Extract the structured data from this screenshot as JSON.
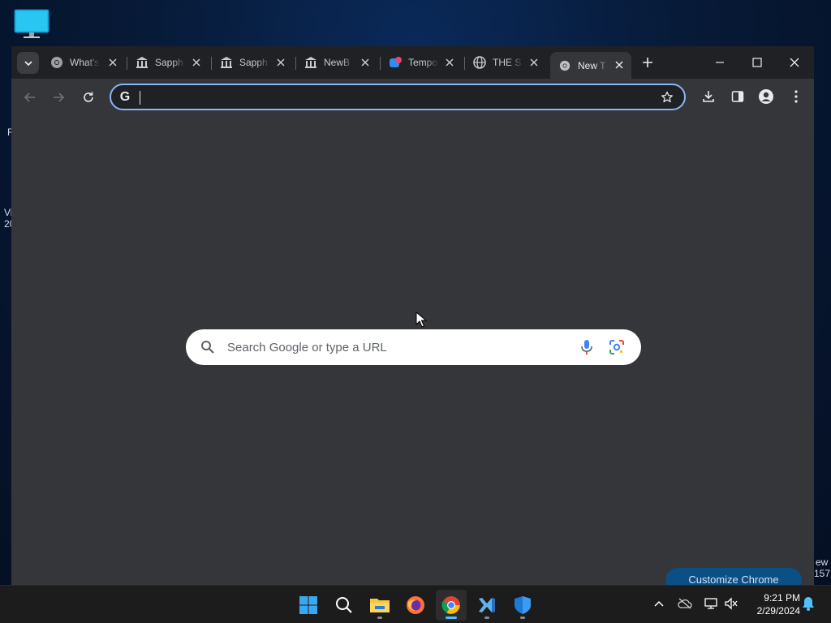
{
  "desktop": {
    "icon_name": "monitor-icon",
    "peek_texts": [
      "R",
      "Vi",
      "20",
      "ew",
      "157"
    ]
  },
  "browser": {
    "tabs": [
      {
        "title": "What's",
        "icon": "chrome-icon"
      },
      {
        "title": "Sapph",
        "icon": "bank-icon"
      },
      {
        "title": "Sapph",
        "icon": "bank-icon"
      },
      {
        "title": "NewB",
        "icon": "bank-icon"
      },
      {
        "title": "Tempo",
        "icon": "tempo-icon"
      },
      {
        "title": "THE S",
        "icon": "globe-icon"
      },
      {
        "title": "New T",
        "icon": "chrome-icon",
        "active": true
      }
    ],
    "omnibox": {
      "value": "",
      "placeholder": ""
    },
    "ntp": {
      "search_placeholder": "Search Google or type a URL",
      "customize_label": "Customize Chrome"
    }
  },
  "taskbar": {
    "apps": [
      "start-icon",
      "search-icon",
      "file-explorer-icon",
      "firefox-icon",
      "chrome-icon",
      "visual-studio-icon",
      "defender-icon"
    ],
    "clock_time": "9:21 PM",
    "clock_date": "2/29/2024"
  },
  "colors": {
    "accent": "#8ab4f8",
    "tabstrip": "#202124",
    "toolbar": "#35363a",
    "taskbar": "#1c1c1c",
    "customize_bg": "#0b4f84"
  }
}
